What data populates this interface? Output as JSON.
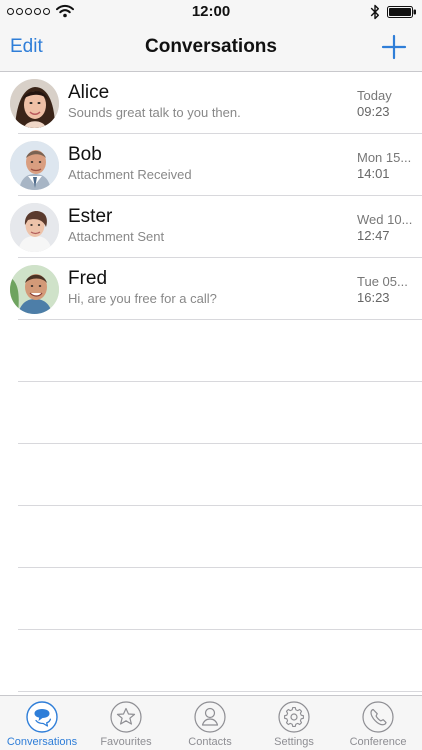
{
  "status_bar": {
    "time": "12:00",
    "signal_dots": 5,
    "wifi_icon": "wifi-icon",
    "bluetooth_icon": "bluetooth-icon",
    "battery_icon": "battery-icon"
  },
  "nav": {
    "edit_label": "Edit",
    "title": "Conversations",
    "add_icon": "plus-icon"
  },
  "conversations": [
    {
      "name": "Alice",
      "preview": "Sounds great talk to you then.",
      "date": "Today",
      "time": "09:23",
      "avatar": "avatar-alice"
    },
    {
      "name": "Bob",
      "preview": "Attachment Received",
      "date": "Mon 15...",
      "time": "14:01",
      "avatar": "avatar-bob"
    },
    {
      "name": "Ester",
      "preview": "Attachment Sent",
      "date": "Wed 10...",
      "time": "12:47",
      "avatar": "avatar-ester"
    },
    {
      "name": "Fred",
      "preview": "Hi, are you free for a call?",
      "date": "Tue 05...",
      "time": "16:23",
      "avatar": "avatar-fred"
    }
  ],
  "tabs": [
    {
      "label": "Conversations",
      "icon": "chat-bubble-icon",
      "active": true
    },
    {
      "label": "Favourites",
      "icon": "star-icon",
      "active": false
    },
    {
      "label": "Contacts",
      "icon": "person-icon",
      "active": false
    },
    {
      "label": "Settings",
      "icon": "gear-icon",
      "active": false
    },
    {
      "label": "Conference",
      "icon": "phone-icon",
      "active": false
    }
  ],
  "colors": {
    "accent": "#2f7ed8",
    "bar_background": "#f6f6f6",
    "divider": "#d8d8dc",
    "secondary_text": "#888888",
    "inactive_tab": "#8e8e93"
  }
}
